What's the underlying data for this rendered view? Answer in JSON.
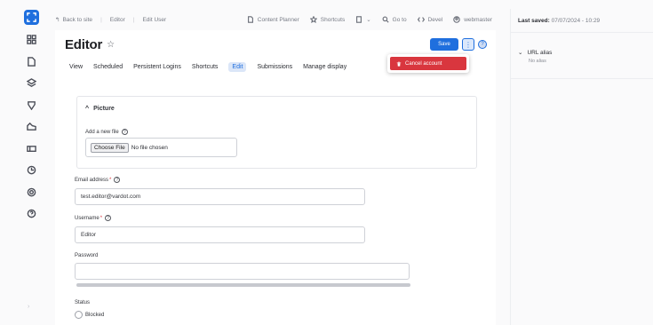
{
  "topbar": {
    "back_label": "Back to site",
    "crumb_user": "Editor",
    "crumb_action": "Edit User",
    "tools": [
      {
        "icon": "file-icon",
        "label": "Content Planner"
      },
      {
        "icon": "star-icon",
        "label": "Shortcuts"
      },
      {
        "icon": "page-icon",
        "label": ""
      },
      {
        "icon": "search-icon",
        "label": "Go to"
      },
      {
        "icon": "code-icon",
        "label": "Devel"
      },
      {
        "icon": "user-icon",
        "label": "webmaster"
      }
    ]
  },
  "header": {
    "title": "Editor",
    "save_label": "Save",
    "more_label": "⋮",
    "help_label": "?"
  },
  "tabs": [
    {
      "label": "View",
      "active": false
    },
    {
      "label": "Scheduled",
      "active": false
    },
    {
      "label": "Persistent Logins",
      "active": false
    },
    {
      "label": "Shortcuts",
      "active": false
    },
    {
      "label": "Edit",
      "active": true
    },
    {
      "label": "Submissions",
      "active": false
    },
    {
      "label": "Manage display",
      "active": false
    }
  ],
  "dropdown": {
    "cancel_label": "Cancel account"
  },
  "form": {
    "picture_legend": "Picture",
    "add_file_label": "Add a new file",
    "choose_file": "Choose File",
    "no_file": "No file chosen",
    "email_label": "Email address",
    "email_value": "test.editor@vardot.com",
    "username_label": "Username",
    "username_value": "Editor",
    "password_label": "Password",
    "password_value": "",
    "status_label": "Status",
    "blocked_label": "Blocked"
  },
  "panel": {
    "last_saved_label": "Last saved:",
    "last_saved_value": "07/07/2024 - 10:29",
    "url_alias_label": "URL alias",
    "url_alias_value": "No alias"
  },
  "colors": {
    "accent": "#1f6fde",
    "danger": "#d9363e"
  }
}
